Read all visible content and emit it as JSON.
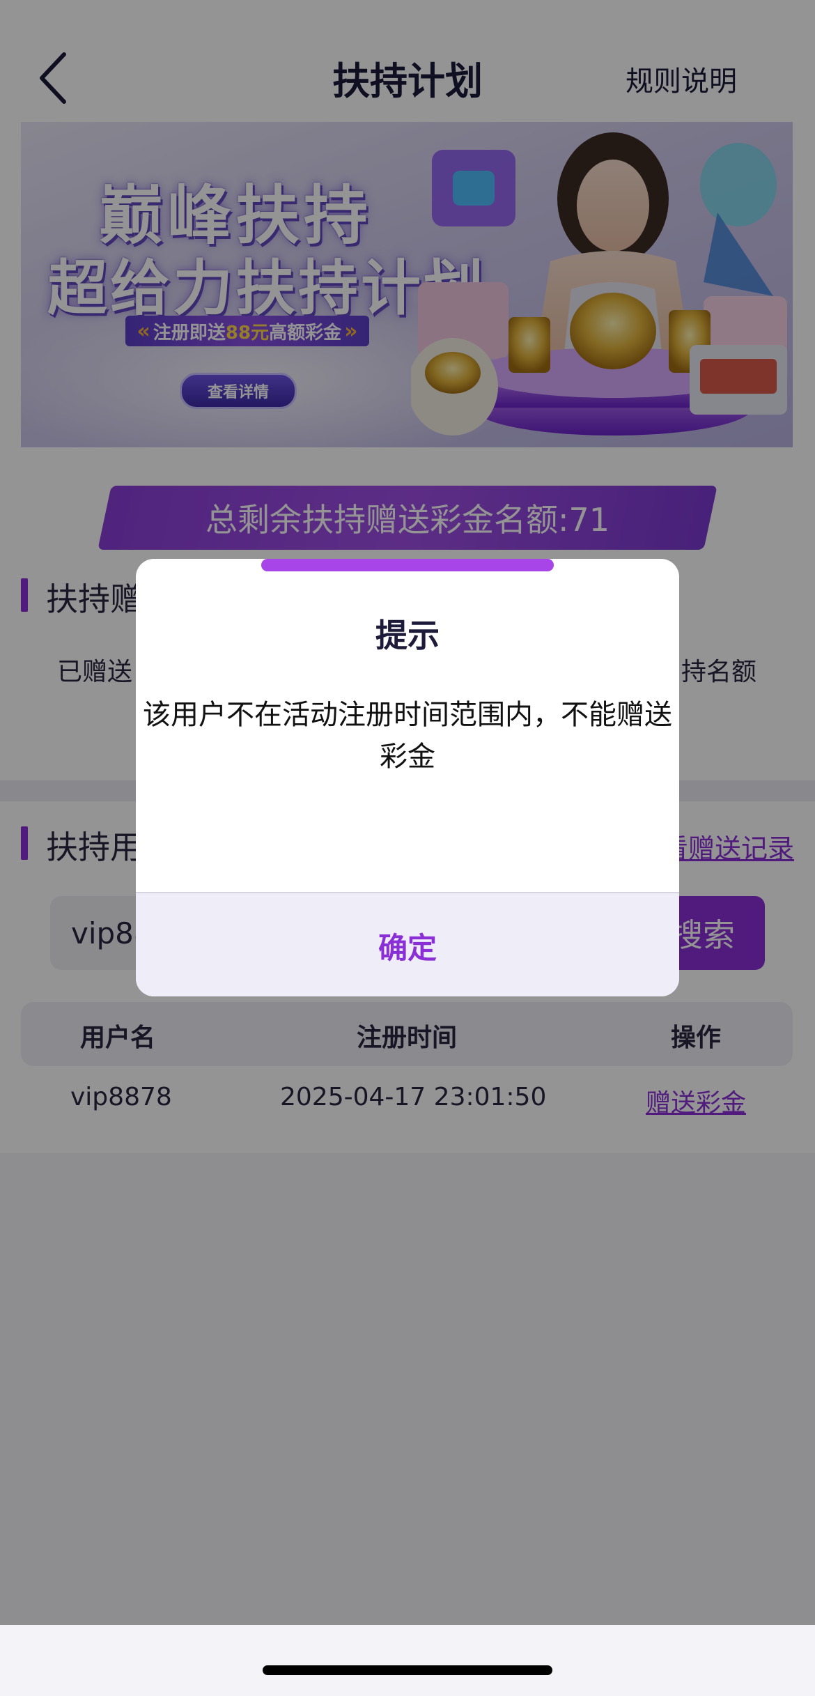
{
  "header": {
    "title": "扶持计划",
    "rules_label": "规则说明"
  },
  "banner": {
    "headline_1": "巅峰扶持",
    "headline_2": "超给力扶持计划",
    "tag_prefix": "注册即送",
    "tag_amount": "88元",
    "tag_suffix": "高额彩金",
    "detail_button": "查看详情"
  },
  "quota_text": "总剩余扶持赠送彩金名额:71",
  "section_stats": {
    "title_partial": "扶持赠",
    "left_label_partial": "已赠送",
    "right_label_partial": "持名额"
  },
  "section_users": {
    "title_partial": "扶持用",
    "record_link_partial": "看赠送记录"
  },
  "search": {
    "value_partial": "vip88",
    "button_partial": "搜索"
  },
  "table": {
    "headers": [
      "用户名",
      "注册时间",
      "操作"
    ],
    "rows": [
      {
        "username": "vip8878",
        "register_time": "2025-04-17 23:01:50",
        "action": "赠送彩金"
      }
    ]
  },
  "dialog": {
    "title": "提示",
    "message": "该用户不在活动注册时间范围内，不能赠送彩金",
    "confirm_label": "确定"
  },
  "colors": {
    "accent": "#8a2fd6",
    "overlay": "rgba(0,0,0,0.42)"
  }
}
